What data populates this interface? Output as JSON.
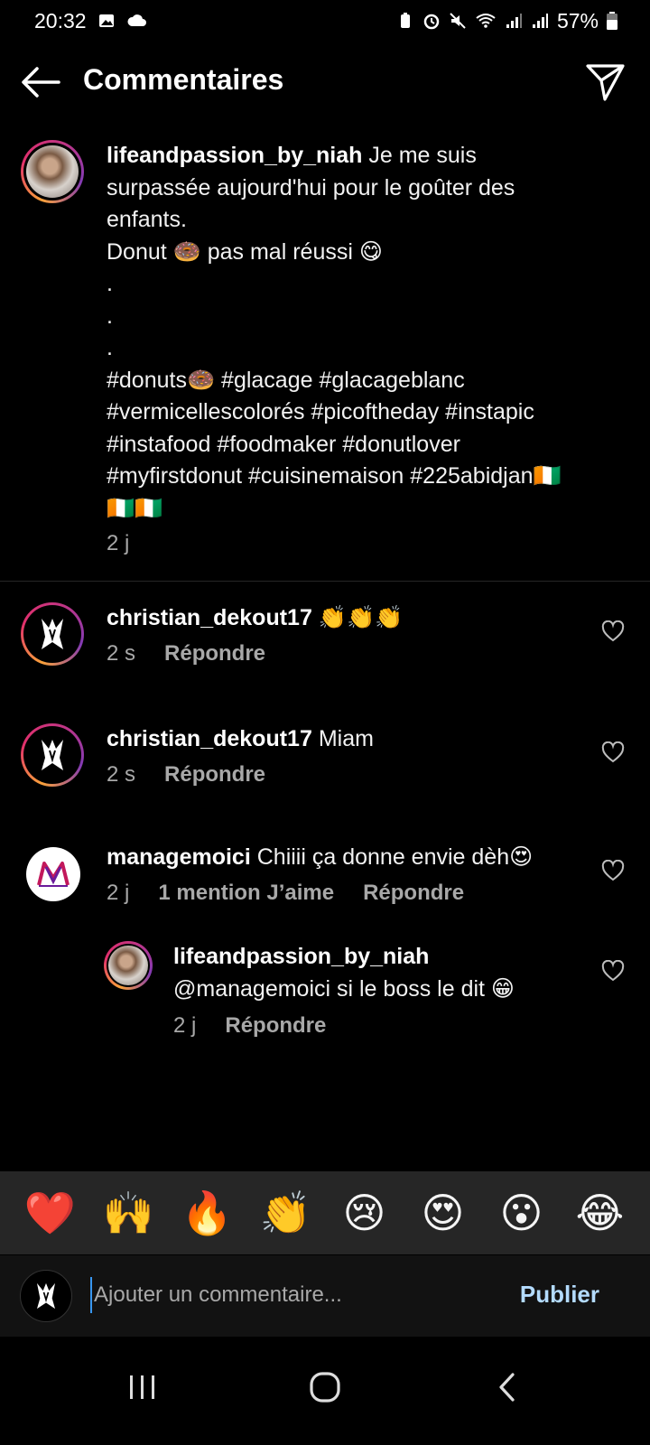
{
  "status_bar": {
    "time": "20:32",
    "battery": "57%",
    "icons": [
      "image-icon",
      "cloud-icon",
      "battery-saver-icon",
      "alarm-icon",
      "mute-icon",
      "wifi-icon",
      "signal-icon",
      "signal-icon",
      "battery-icon"
    ]
  },
  "header": {
    "title": "Commentaires",
    "back_icon": "arrow-left-icon",
    "send_icon": "paper-plane-icon"
  },
  "caption": {
    "username": "lifeandpassion_by_niah",
    "text": "Je me suis surpassée aujourd'hui pour le goûter des enfants.\nDonut 🍩 pas mal réussi 😋\n.\n.\n.\n#donuts🍩 #glacage #glacageblanc #vermicellescolorés #picoftheday #instapic #instafood #foodmaker #donutlover #myfirstdonut #cuisinemaison #225abidjan🇨🇮🇨🇮🇨🇮",
    "time": "2 j"
  },
  "comments": [
    {
      "username": "christian_dekout17",
      "text": "👏👏👏",
      "time": "2 s",
      "likes": "",
      "reply_label": "Répondre"
    },
    {
      "username": "christian_dekout17",
      "text": "Miam",
      "time": "2 s",
      "likes": "",
      "reply_label": "Répondre"
    },
    {
      "username": "managemoici",
      "text": "Chiiii ça donne envie dèh😍",
      "time": "2 j",
      "likes": "1 mention J’aime",
      "reply_label": "Répondre"
    },
    {
      "username": "lifeandpassion_by_niah",
      "text": "@managemoici si le boss le dit 😁",
      "time": "2 j",
      "likes": "",
      "reply_label": "Répondre"
    }
  ],
  "emoji_bar": [
    "❤️",
    "🙌",
    "🔥",
    "👏",
    "😢",
    "😍",
    "😮",
    "😂"
  ],
  "input": {
    "placeholder": "Ajouter un commentaire...",
    "value": "",
    "publish_label": "Publier"
  },
  "nav_bar": {
    "icons": [
      "recent-apps-icon",
      "home-icon",
      "back-icon"
    ]
  },
  "colors": {
    "background": "#000000",
    "secondary_text": "#a8a8a8",
    "publish": "#b3dbff",
    "emoji_bar_bg": "#262626"
  }
}
